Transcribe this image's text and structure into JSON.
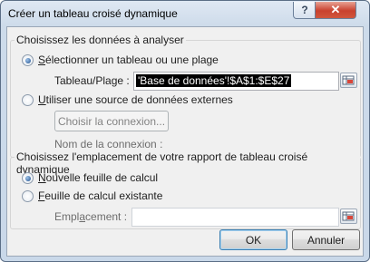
{
  "dialog": {
    "title": "Créer un tableau croisé dynamique",
    "help_glyph": "?",
    "close_glyph": "✕"
  },
  "source_group": {
    "legend": "Choisissez les données à analyser",
    "option_range": {
      "label_accel": "S",
      "label_rest": "électionner un tableau ou une plage",
      "checked": true
    },
    "range_field": {
      "label": "Tableau/Plage :",
      "value": "'Base de données'!$A$1:$E$27"
    },
    "option_external": {
      "label_accel": "U",
      "label_rest": "tiliser une source de données externes",
      "checked": false
    },
    "choose_connection_button": "Choisir la connexion...",
    "connection_name_label": "Nom de la connexion :"
  },
  "placement_group": {
    "legend": "Choisissez l'emplacement de votre rapport de tableau croisé dynamique",
    "option_new_sheet": {
      "label_accel": "N",
      "label_rest": "ouvelle feuille de calcul",
      "checked": true
    },
    "option_existing_sheet": {
      "label_accel": "F",
      "label_rest": "euille de calcul existante",
      "checked": false
    },
    "location_field": {
      "label_pre": "Empl",
      "label_accel": "a",
      "label_post": "cement :",
      "value": ""
    }
  },
  "buttons": {
    "ok": "OK",
    "cancel": "Annuler"
  },
  "icons": {
    "range_picker": "range-picker-icon"
  },
  "colors": {
    "title_gradient_top": "#dfe8f3",
    "close_red": "#c9412e",
    "client_bg": "#f0f0f0",
    "radio_dot": "#1e4e8c"
  }
}
